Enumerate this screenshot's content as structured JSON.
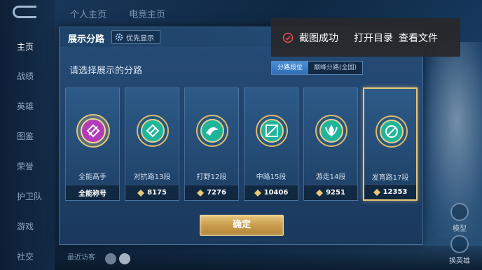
{
  "nav": {
    "items": [
      "主页",
      "战绩",
      "英雄",
      "图鉴",
      "荣誉",
      "护卫队",
      "游戏",
      "社交"
    ],
    "active_index": 0
  },
  "top_tabs": [
    "个人主页",
    "电竞主页"
  ],
  "bottom": {
    "recent_label": "最近访客",
    "right_buttons": [
      "模型",
      "换英雄"
    ]
  },
  "dialog": {
    "title": "展示分路",
    "priority_label": "优先显示",
    "subtitle": "请选择展示的分路",
    "toggle": {
      "active": "分路段位",
      "inactive": "巅峰分路(全国)"
    },
    "cards": [
      {
        "name": "全能高手",
        "foot": "全能称号",
        "badge_color": "#b23bb8",
        "has_power": false
      },
      {
        "name": "对抗路13段",
        "foot": "8175",
        "badge_color": "#1fb59a",
        "has_power": true
      },
      {
        "name": "打野12段",
        "foot": "7276",
        "badge_color": "#1fb59a",
        "has_power": true
      },
      {
        "name": "中路15段",
        "foot": "10406",
        "badge_color": "#1fb59a",
        "has_power": true
      },
      {
        "name": "游走14段",
        "foot": "9251",
        "badge_color": "#1fb59a",
        "has_power": true
      },
      {
        "name": "发育路17段",
        "foot": "12353",
        "badge_color": "#1fb59a",
        "has_power": true
      }
    ],
    "selected_index": 5,
    "confirm_label": "确定"
  },
  "toast": {
    "message": "截图成功",
    "open_dir": "打开目录",
    "view_file": "查看文件"
  },
  "colors": {
    "accent_gold": "#e7c778",
    "badge_teal": "#1fb59a",
    "badge_purple": "#b23bb8",
    "toast_icon": "#e84b4b"
  }
}
